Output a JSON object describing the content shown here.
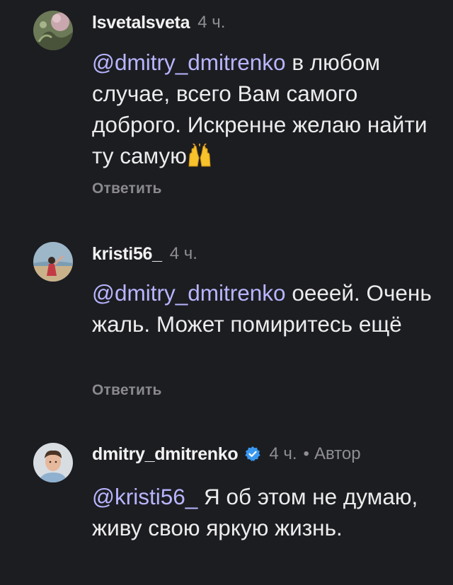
{
  "comments": [
    {
      "username": "lsvetalsveta",
      "time": "4 ч.",
      "mention": "@dmitry_dmitrenko",
      "text": " в любом случае, всего Вам самого доброго. Искренне желаю найти ту самую",
      "emoji": "raising-hands-emoji",
      "reply_label": "Ответить"
    },
    {
      "username": "kristi56_",
      "time": "4 ч.",
      "mention": "@dmitry_dmitrenko",
      "text": " оееей. Очень жаль. Может помиритесь ещё",
      "reply_label": "Ответить"
    },
    {
      "username": "dmitry_dmitrenko",
      "verified": true,
      "time": "4 ч.",
      "separator": "•",
      "author_label": "Автор",
      "mention": "@kristi56_",
      "text": " Я об этом не думаю, живу свою яркую жизнь."
    }
  ],
  "colors": {
    "background": "#1c1d21",
    "mention": "#b9b5ff",
    "verified_badge": "#3897f0",
    "muted": "#8e8e93"
  }
}
